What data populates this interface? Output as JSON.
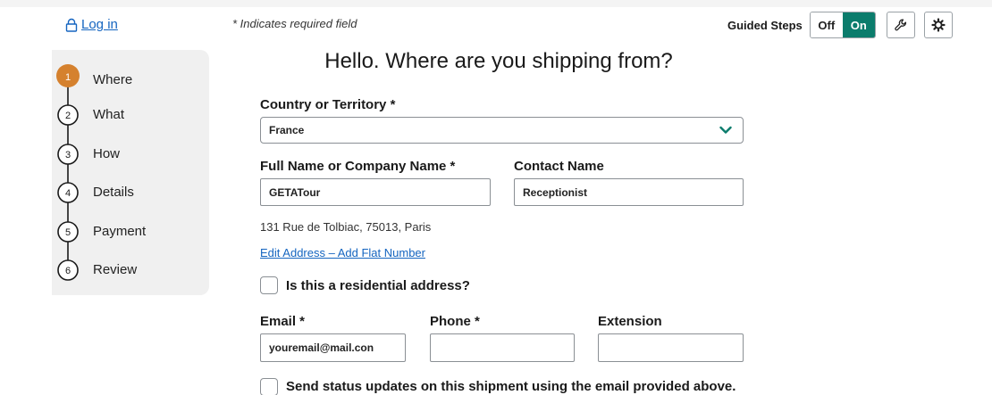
{
  "header": {
    "login_label": "Log in",
    "required_note": "* Indicates required field",
    "guided_steps_label": "Guided Steps",
    "toggle_off": "Off",
    "toggle_on": "On"
  },
  "stepper": {
    "steps": [
      {
        "number": "1",
        "label": "Where",
        "active": true
      },
      {
        "number": "2",
        "label": "What",
        "active": false
      },
      {
        "number": "3",
        "label": "How",
        "active": false
      },
      {
        "number": "4",
        "label": "Details",
        "active": false
      },
      {
        "number": "5",
        "label": "Payment",
        "active": false
      },
      {
        "number": "6",
        "label": "Review",
        "active": false
      }
    ]
  },
  "form": {
    "heading": "Hello. Where are you shipping from?",
    "country_label": "Country or Territory *",
    "country_value": "France",
    "fullname_label": "Full Name or Company Name *",
    "fullname_value": "GETATour",
    "contact_label": "Contact Name",
    "contact_value": "Receptionist",
    "address_text": "131 Rue de Tolbiac, 75013, Paris",
    "edit_address_link": "Edit Address – Add Flat Number",
    "residential_label": "Is this a residential address?",
    "email_label": "Email *",
    "email_value": "youremail@mail.con",
    "phone_label": "Phone *",
    "phone_value": "",
    "extension_label": "Extension",
    "extension_value": "",
    "status_updates_label": "Send status updates on this shipment using the email provided above."
  },
  "colors": {
    "accent_teal": "#0b7c6c",
    "active_step": "#d5812e",
    "link_blue": "#1565c0"
  },
  "icons": [
    "lock-icon",
    "wrench-icon",
    "gear-icon",
    "chevron-down-icon"
  ]
}
